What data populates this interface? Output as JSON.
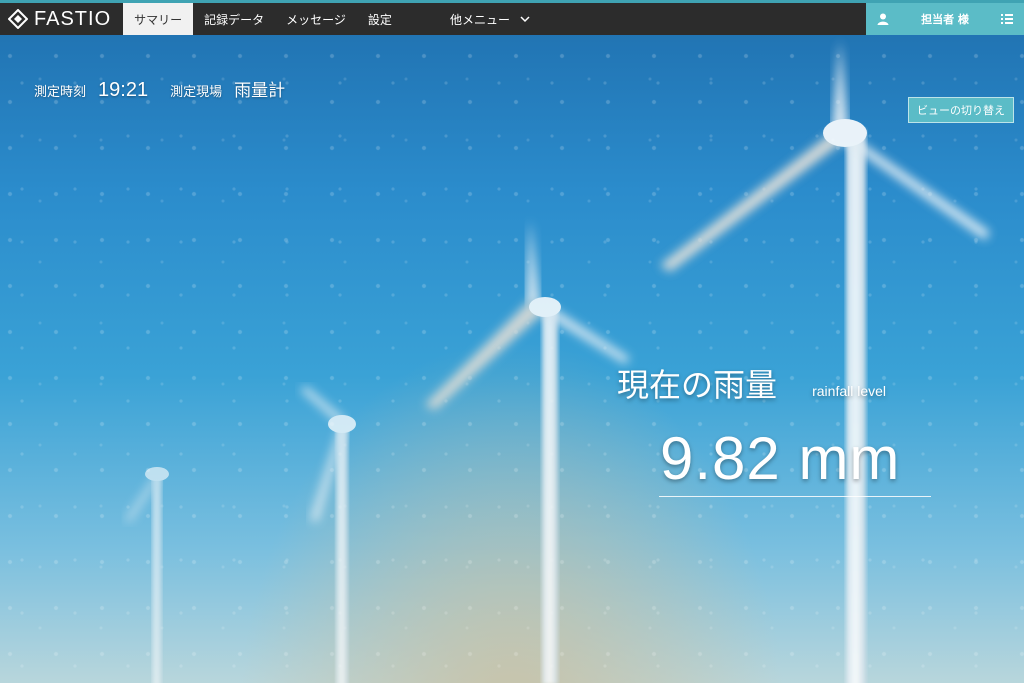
{
  "app": {
    "logo_text": "FASTIO"
  },
  "nav": {
    "items": [
      {
        "label": "サマリー",
        "active": true
      },
      {
        "label": "記録データ",
        "active": false
      },
      {
        "label": "メッセージ",
        "active": false
      },
      {
        "label": "設定",
        "active": false
      }
    ],
    "other_menu": "他メニュー",
    "user": "担当者 様"
  },
  "info": {
    "time_label": "測定時刻",
    "time_value": "19:21",
    "site_label": "測定現場",
    "site_value": "雨量計"
  },
  "view_switch_label": "ビューの切り替え",
  "reading": {
    "title": "現在の雨量",
    "subtitle": "rainfall level",
    "value": "9.82 mm"
  },
  "colors": {
    "accent": "#5bbcc7",
    "nav_bg": "#2c2c2c"
  }
}
